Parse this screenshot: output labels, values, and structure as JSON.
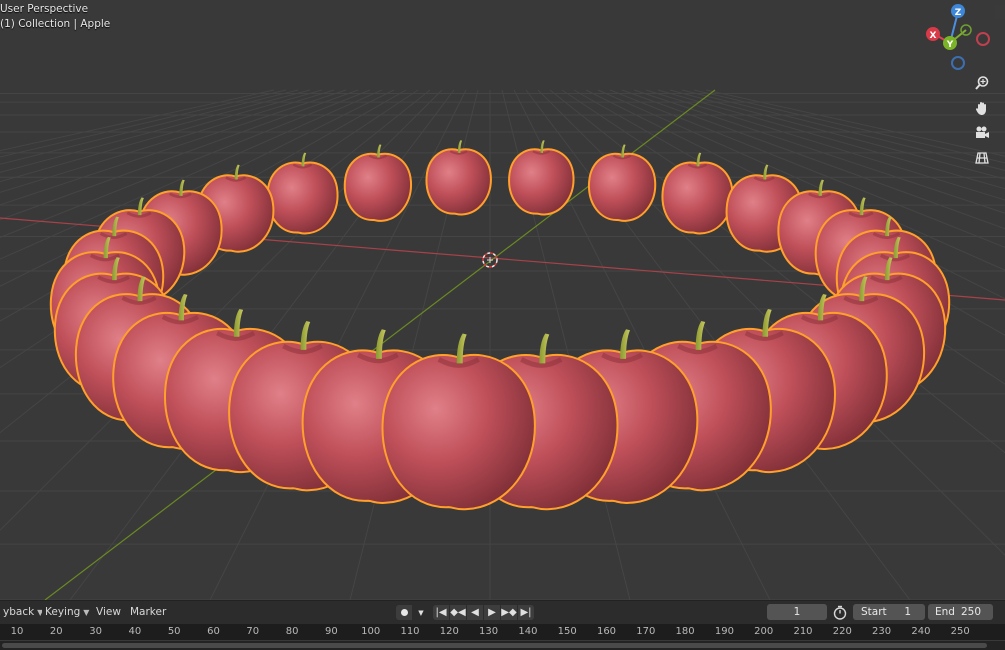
{
  "viewport": {
    "title": "User Perspective",
    "collection": "(1) Collection | Apple",
    "gizmo": {
      "z": "Z",
      "x": "X",
      "y": "Y"
    },
    "nav_icons": [
      "zoom-icon",
      "hand-pan-icon",
      "camera-icon",
      "grid-icon"
    ],
    "colors": {
      "background": "#393939",
      "apple": "#c0505a",
      "outline": "#ffa02c",
      "x_axis": "#a8424a",
      "y_axis": "#6a8a22"
    }
  },
  "timeline": {
    "playback": "yback",
    "keying": "Keying",
    "view": "View",
    "marker": "Marker",
    "current_frame": "1",
    "start_label": "Start",
    "start_value": "1",
    "end_label": "End",
    "end_value": "250",
    "ruler": [
      "10",
      "20",
      "30",
      "40",
      "50",
      "60",
      "70",
      "80",
      "90",
      "100",
      "110",
      "120",
      "130",
      "140",
      "150",
      "160",
      "170",
      "180",
      "190",
      "200",
      "210",
      "220",
      "230",
      "240",
      "250"
    ]
  }
}
